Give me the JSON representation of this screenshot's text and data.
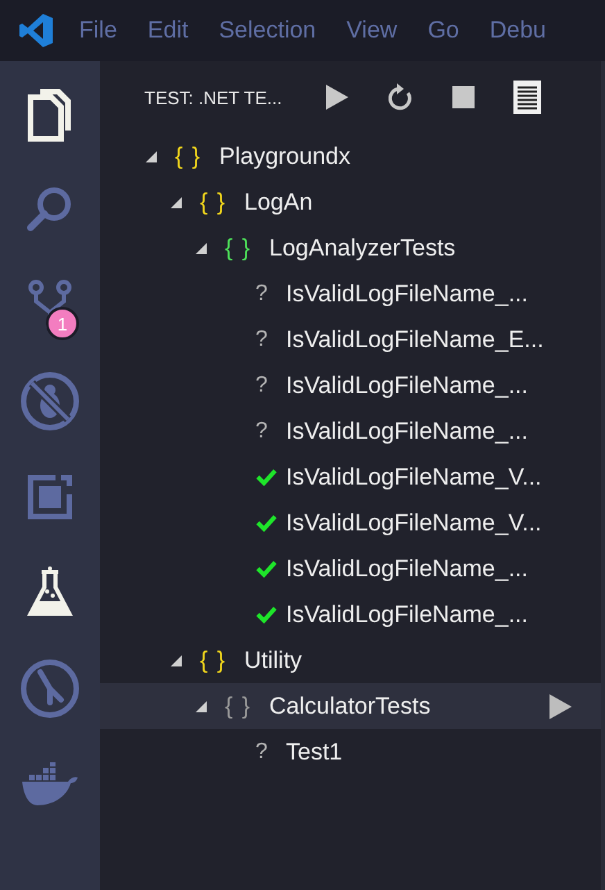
{
  "menu_bar": {
    "items": [
      "File",
      "Edit",
      "Selection",
      "View",
      "Go",
      "Debu"
    ]
  },
  "activity_bar": {
    "items": [
      {
        "kind": "files",
        "highlighted": true
      },
      {
        "kind": "search",
        "highlighted": false
      },
      {
        "kind": "source-control",
        "highlighted": false,
        "badge": "1"
      },
      {
        "kind": "debug",
        "highlighted": false
      },
      {
        "kind": "extensions",
        "highlighted": false
      },
      {
        "kind": "test",
        "highlighted": true
      },
      {
        "kind": "git-graph",
        "highlighted": false
      },
      {
        "kind": "docker",
        "highlighted": false
      }
    ]
  },
  "sidebar": {
    "title": "TEST: .NET TE...",
    "actions": [
      {
        "kind": "run"
      },
      {
        "kind": "refresh"
      },
      {
        "kind": "stop"
      },
      {
        "kind": "log"
      }
    ],
    "tree": [
      {
        "kind": "namespace",
        "icon": "{ }",
        "label": "Playgroundx",
        "expanded": true,
        "selected": false,
        "children": [
          {
            "kind": "namespace",
            "icon": "{ }",
            "label": "LogAn",
            "expanded": true,
            "selected": false,
            "children": [
              {
                "kind": "class",
                "icon": "{ }",
                "label": "LogAnalyzerTests",
                "expanded": true,
                "selected": false,
                "children": [
                  {
                    "kind": "test",
                    "icon": "?",
                    "label": "IsValidLogFileName_...",
                    "passed": false,
                    "selected": false
                  },
                  {
                    "kind": "test",
                    "icon": "?",
                    "label": "IsValidLogFileName_E...",
                    "passed": false,
                    "selected": false
                  },
                  {
                    "kind": "test",
                    "icon": "?",
                    "label": "IsValidLogFileName_...",
                    "passed": false,
                    "selected": false
                  },
                  {
                    "kind": "test",
                    "icon": "?",
                    "label": "IsValidLogFileName_...",
                    "passed": false,
                    "selected": false
                  },
                  {
                    "kind": "test",
                    "label": "IsValidLogFileName_V...",
                    "passed": true,
                    "selected": false
                  },
                  {
                    "kind": "test",
                    "label": "IsValidLogFileName_V...",
                    "passed": true,
                    "selected": false
                  },
                  {
                    "kind": "test",
                    "label": "IsValidLogFileName_...",
                    "passed": true,
                    "selected": false
                  },
                  {
                    "kind": "test",
                    "label": "IsValidLogFileName_...",
                    "passed": true,
                    "selected": false
                  }
                ]
              }
            ]
          },
          {
            "kind": "namespace",
            "icon": "{ }",
            "label": "Utility",
            "expanded": true,
            "selected": false,
            "children": [
              {
                "kind": "class",
                "icon": "{ }",
                "label": "CalculatorTests",
                "expanded": true,
                "selected": true,
                "children": [
                  {
                    "kind": "test",
                    "icon": "?",
                    "label": "Test1",
                    "passed": false,
                    "selected": false
                  }
                ]
              }
            ]
          }
        ]
      }
    ]
  }
}
